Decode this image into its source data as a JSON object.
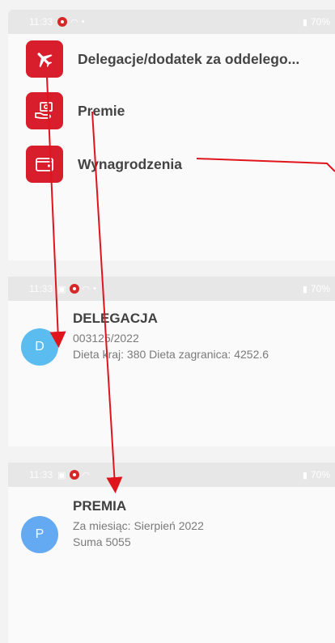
{
  "statusbar": {
    "time": "11:33",
    "battery": "70%"
  },
  "menu": {
    "items": [
      {
        "label": "Delegacje/dodatek za oddelego...",
        "icon": "airplane-icon"
      },
      {
        "label": "Premie",
        "icon": "money-hand-icon"
      },
      {
        "label": "Wynagrodzenia",
        "icon": "wallet-icon"
      }
    ]
  },
  "delegation": {
    "avatar": "D",
    "title": "DELEGACJA",
    "number": "003125/2022",
    "details": "Dieta kraj: 380 Dieta zagranica: 4252.6"
  },
  "bonus": {
    "avatar": "P",
    "title": "PREMIA",
    "month": "Za miesiąc: Sierpień 2022",
    "sum": "Suma 5055"
  },
  "colors": {
    "accent": "#d81e2c",
    "avatar_d": "#5bbcf0",
    "avatar_p": "#63aaf2",
    "arrow": "#e0141c"
  }
}
